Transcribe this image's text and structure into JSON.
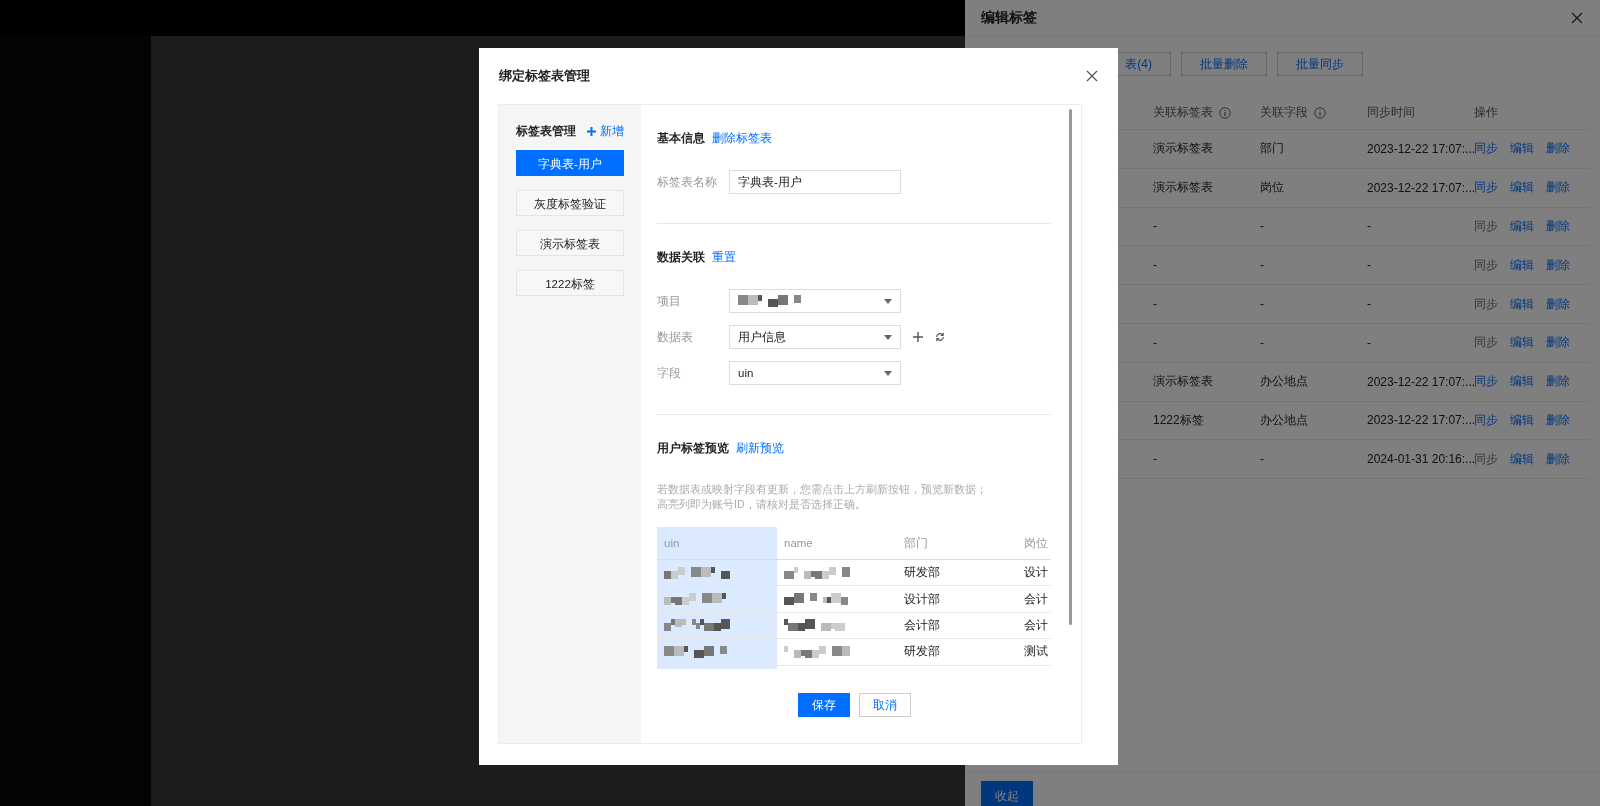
{
  "drawer": {
    "title": "编辑标签",
    "toolbar_buttons": [
      "表(4)",
      "批量删除",
      "批量同步"
    ],
    "table": {
      "columns": [
        {
          "label": "关联标签表",
          "info": true
        },
        {
          "label": "关联字段",
          "info": true
        },
        {
          "label": "同步时间",
          "info": false
        },
        {
          "label": "操作",
          "info": false
        }
      ],
      "rows": [
        {
          "cells": [
            "演示标签表",
            "部门",
            "2023-12-22 17:07:..."
          ],
          "actions": [
            {
              "label": "同步",
              "disabled": false
            },
            {
              "label": "编辑",
              "disabled": false
            },
            {
              "label": "删除",
              "disabled": false
            }
          ]
        },
        {
          "cells": [
            "演示标签表",
            "岗位",
            "2023-12-22 17:07:..."
          ],
          "actions": [
            {
              "label": "同步",
              "disabled": false
            },
            {
              "label": "编辑",
              "disabled": false
            },
            {
              "label": "删除",
              "disabled": false
            }
          ]
        },
        {
          "cells": [
            "-",
            "-",
            "-"
          ],
          "actions": [
            {
              "label": "同步",
              "disabled": true
            },
            {
              "label": "编辑",
              "disabled": false
            },
            {
              "label": "删除",
              "disabled": false
            }
          ]
        },
        {
          "cells": [
            "-",
            "-",
            "-"
          ],
          "actions": [
            {
              "label": "同步",
              "disabled": true
            },
            {
              "label": "编辑",
              "disabled": false
            },
            {
              "label": "删除",
              "disabled": false
            }
          ]
        },
        {
          "cells": [
            "-",
            "-",
            "-"
          ],
          "actions": [
            {
              "label": "同步",
              "disabled": true
            },
            {
              "label": "编辑",
              "disabled": false
            },
            {
              "label": "删除",
              "disabled": false
            }
          ]
        },
        {
          "cells": [
            "-",
            "-",
            "-"
          ],
          "actions": [
            {
              "label": "同步",
              "disabled": true
            },
            {
              "label": "编辑",
              "disabled": false
            },
            {
              "label": "删除",
              "disabled": false
            }
          ]
        },
        {
          "cells": [
            "演示标签表",
            "办公地点",
            "2023-12-22 17:07:..."
          ],
          "actions": [
            {
              "label": "同步",
              "disabled": false
            },
            {
              "label": "编辑",
              "disabled": false
            },
            {
              "label": "删除",
              "disabled": false
            }
          ]
        },
        {
          "cells": [
            "1222标签",
            "办公地点",
            "2023-12-22 17:07:..."
          ],
          "actions": [
            {
              "label": "同步",
              "disabled": false
            },
            {
              "label": "编辑",
              "disabled": false
            },
            {
              "label": "删除",
              "disabled": false
            }
          ]
        },
        {
          "cells": [
            "-",
            "-",
            "2024-01-31 20:16:..."
          ],
          "actions": [
            {
              "label": "同步",
              "disabled": true
            },
            {
              "label": "编辑",
              "disabled": false
            },
            {
              "label": "删除",
              "disabled": false
            }
          ]
        }
      ]
    },
    "collapse_button": "收起"
  },
  "modal": {
    "title": "绑定标签表管理",
    "side": {
      "heading": "标签表管理",
      "add_link": "新增",
      "items": [
        {
          "label": "字典表-用户",
          "selected": true
        },
        {
          "label": "灰度标签验证",
          "selected": false
        },
        {
          "label": "演示标签表",
          "selected": false
        },
        {
          "label": "1222标签",
          "selected": false
        }
      ]
    },
    "basic": {
      "heading": "基本信息",
      "link": "删除标签表",
      "name_label": "标签表名称",
      "name_value": "字典表-用户"
    },
    "binding": {
      "heading": "数据关联",
      "link": "重置",
      "fields": [
        {
          "label": "项目",
          "kind": "redacted"
        },
        {
          "label": "数据表",
          "kind": "select-actions",
          "value": "用户信息"
        },
        {
          "label": "字段",
          "kind": "select",
          "value": "uin"
        }
      ]
    },
    "preview": {
      "heading": "用户标签预览",
      "link": "刷新预览",
      "hint_lines": [
        "若数据表或映射字段有更新，您需点击上方刷新按钮，预览新数据；",
        "高亮列即为账号ID，请核对是否选择正确。"
      ],
      "columns": [
        {
          "label": "uin",
          "highlighted": true
        },
        {
          "label": "name",
          "highlighted": false
        },
        {
          "label": "部门",
          "highlighted": false
        },
        {
          "label": "岗位",
          "highlighted": false
        }
      ],
      "rows": [
        [
          {
            "kind": "redacted"
          },
          {
            "kind": "redacted"
          },
          {
            "kind": "text",
            "text": "研发部"
          },
          {
            "kind": "text",
            "text": "设计"
          }
        ],
        [
          {
            "kind": "redacted"
          },
          {
            "kind": "redacted"
          },
          {
            "kind": "text",
            "text": "设计部"
          },
          {
            "kind": "text",
            "text": "会计"
          }
        ],
        [
          {
            "kind": "redacted"
          },
          {
            "kind": "redacted"
          },
          {
            "kind": "text",
            "text": "会计部"
          },
          {
            "kind": "text",
            "text": "会计"
          }
        ],
        [
          {
            "kind": "redacted"
          },
          {
            "kind": "redacted"
          },
          {
            "kind": "text",
            "text": "研发部"
          },
          {
            "kind": "text",
            "text": "测试"
          }
        ]
      ]
    },
    "buttons": [
      {
        "label": "保存",
        "kind": "primary"
      },
      {
        "label": "取消",
        "kind": "secondary"
      }
    ]
  }
}
